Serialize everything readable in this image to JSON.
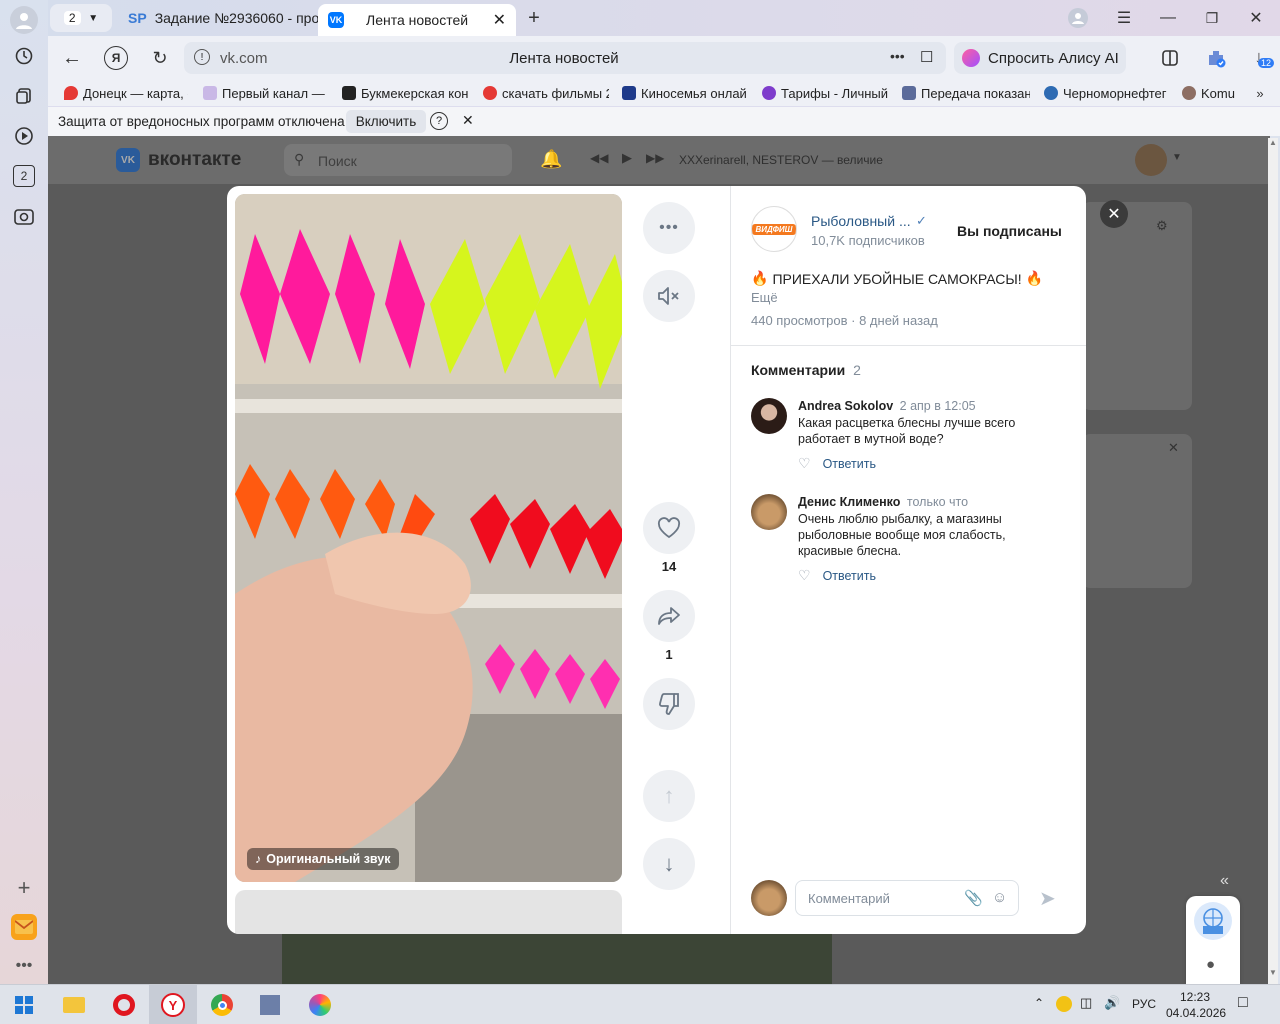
{
  "browser": {
    "tab_count": "2",
    "tabs": [
      {
        "label": "Задание №2936060 - про",
        "icon": "SP"
      },
      {
        "label": "Лента новостей",
        "icon": "vk-logo-icon"
      }
    ],
    "url": "vk.com",
    "page_title": "Лента новостей",
    "alice_label": "Спросить Алису AI",
    "download_badge": "12",
    "sidebar_badge": "2",
    "bookmarks": [
      "Донецк — карта, с",
      "Первый канал — с",
      "Букмекерская кон",
      "скачать фильмы 2",
      "Киносемья онлай",
      "Тарифы - Личный",
      "Передача показан",
      "Черноморнефтег",
      "Komu"
    ],
    "infobar": {
      "text": "Защита от вредоносных программ отключена",
      "button": "Включить",
      "help": "?"
    }
  },
  "vk": {
    "logo": "вконтакте",
    "search_placeholder": "Поиск",
    "now_playing": "XXXerinarell, NESTEROV — величие"
  },
  "clip": {
    "sound_label": "Оригинальный звук",
    "likes": "14",
    "shares": "1",
    "author": "Рыболовный ...",
    "author_logo": "ВИДФИШ",
    "subscribers": "10,7K подписчиков",
    "subscribed_label": "Вы подписаны",
    "caption": "ПРИЕХАЛИ УБОЙНЫЕ САМОКРАСЫ!",
    "more_label": "Ещё",
    "views": "440 просмотров",
    "posted": "8 дней назад",
    "comments_title": "Комментарии",
    "comments_count": "2",
    "comments": [
      {
        "author": "Andrea Sokolov",
        "time": "2 апр в 12:05",
        "text": "Какая расцветка блесны лучше всего работает в мутной воде?",
        "reply": "Ответить"
      },
      {
        "author": "Денис Клименко",
        "time": "только что",
        "text": "Очень люблю рыбалку, а магазины рыболовные вообще моя слабость, красивые блесна.",
        "reply": "Ответить"
      }
    ],
    "comment_placeholder": "Комментарий"
  },
  "taskbar": {
    "lang": "РУС",
    "time": "12:23",
    "date": "04.04.2026"
  }
}
